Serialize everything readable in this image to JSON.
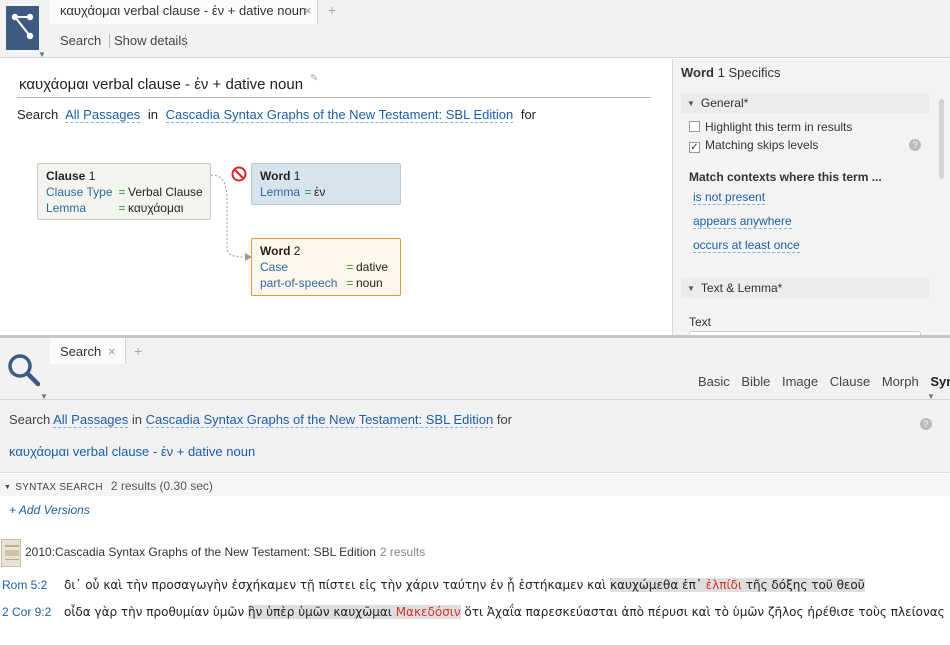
{
  "top_tab": {
    "title": "καυχάομαι verbal clause - ἐν + dative noun",
    "close": "×",
    "add": "+"
  },
  "top_toolbar": {
    "search": "Search",
    "show_details": "Show details"
  },
  "query": {
    "title": "καυχάομαι verbal clause - ἐν + dative noun",
    "search_label": "Search",
    "passages": "All Passages",
    "in_label": "in",
    "resource": "Cascadia Syntax Graphs of the New Testament: SBL Edition",
    "for_label": "for"
  },
  "graph": {
    "clause": {
      "label": "Clause",
      "num": "1",
      "rows": [
        {
          "key": "Clause Type",
          "eq": "=",
          "value": "Verbal Clause"
        },
        {
          "key": "Lemma",
          "eq": "=",
          "value": "καυχάομαι"
        }
      ]
    },
    "word1": {
      "label": "Word",
      "num": "1",
      "rows": [
        {
          "key": "Lemma",
          "eq": "=",
          "value": "ἐν"
        }
      ]
    },
    "word2": {
      "label": "Word",
      "num": "2",
      "rows": [
        {
          "key": "Case",
          "eq": "=",
          "value": "dative"
        },
        {
          "key": "part-of-speech",
          "eq": "=",
          "value": "noun"
        }
      ]
    }
  },
  "specifics": {
    "title_bold": "Word",
    "title_rest": "1 Specifics",
    "general_section": "General*",
    "highlight_label": "Highlight this term in results",
    "highlight_checked": false,
    "skips_label": "Matching skips levels",
    "skips_checked": true,
    "match_label": "Match contexts where this term ...",
    "options": [
      "is not present",
      "appears anywhere",
      "occurs at least once"
    ],
    "text_lemma_section": "Text & Lemma*",
    "text_label": "Text"
  },
  "bottom_tab": {
    "title": "Search",
    "close": "×",
    "add": "+"
  },
  "view_tabs": [
    {
      "label": "Basic",
      "active": false
    },
    {
      "label": "Bible",
      "active": false
    },
    {
      "label": "Image",
      "active": false
    },
    {
      "label": "Clause",
      "active": false
    },
    {
      "label": "Morph",
      "active": false
    },
    {
      "label": "Syntax",
      "active": true
    }
  ],
  "bottom_query": {
    "search_label": "Search",
    "passages": "All Passages",
    "in_label": "in",
    "resource": "Cascadia Syntax Graphs of the New Testament: SBL Edition",
    "for_label": "for",
    "query_name": "καυχάομαι verbal clause - ἐν + dative noun"
  },
  "results": {
    "section_title": "SYNTAX SEARCH",
    "count": "2 results (0.30 sec)",
    "add_versions": "+ Add Versions",
    "edition": "2010:Cascadia Syntax Graphs of the New Testament: SBL Edition",
    "edition_count": "2 results",
    "verses": [
      {
        "ref": "Rom  5:2",
        "pre": "δι᾽ οὗ καὶ τὴν προσαγωγὴν ἐσχήκαμεν τῇ πίστει εἰς τὴν χάριν ταύτην ἐν ᾗ ἑστήκαμεν καὶ ",
        "hl1": "καυχώμεθα ἐπ᾽ ",
        "red": "ἐλπίδι",
        "post": " τῆς δόξης τοῦ θεοῦ"
      },
      {
        "ref": "2 Cor 9:2",
        "pre": "οἶδα γὰρ τὴν προθυμίαν ὑμῶν ",
        "hl1": "ἣν ὑπὲρ ὑμῶν καυχῶμαι ",
        "red": "Μακεδόσιν",
        "post": " ὅτι Ἀχαΐα παρεσκεύασται ἀπὸ πέρυσι καὶ τὸ ὑμῶν ζῆλος ἠρέθισε τοὺς πλείονας"
      }
    ]
  },
  "colors": {
    "accent": "#1b5fa8",
    "highlight_red": "#d9332e",
    "app_icon": "#3d5a80",
    "word2_border": "#e39a3a"
  }
}
